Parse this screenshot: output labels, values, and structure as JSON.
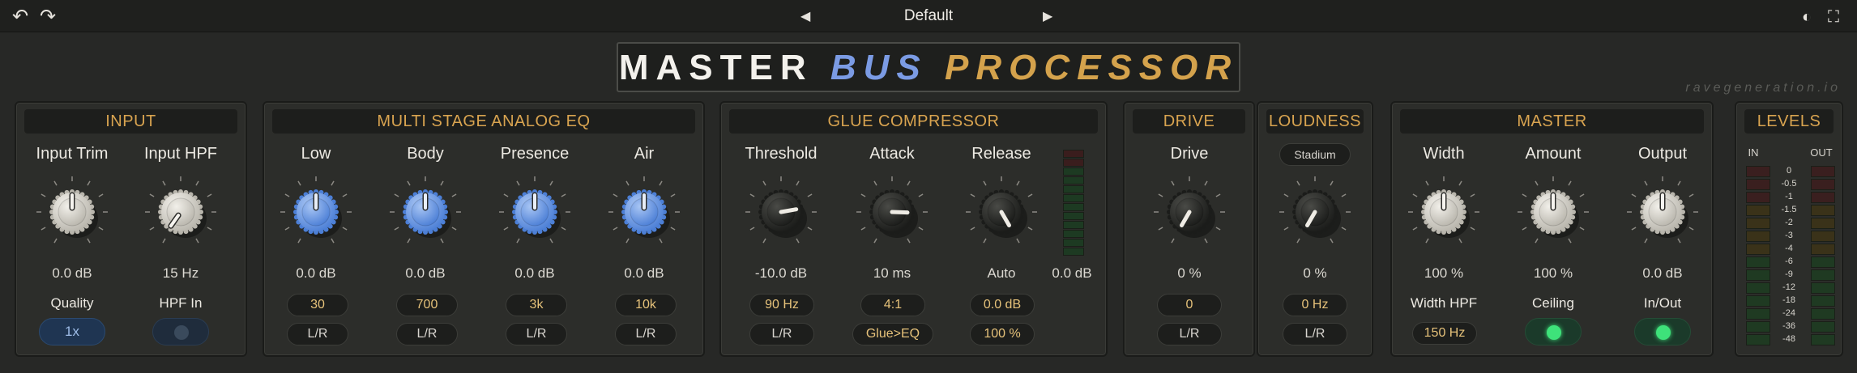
{
  "topbar": {
    "undo": "undo-icon",
    "redo": "redo-icon",
    "preset": "Default",
    "theme": "contrast-icon",
    "fullscreen": "fullscreen-icon"
  },
  "title": {
    "part1": "MASTER",
    "part2": "BUS",
    "part3": "PROCESSOR"
  },
  "brand": "ravegeneration.io",
  "colors": {
    "accent": "#d9a450",
    "blue": "#7b9be4",
    "green": "#3ee27a"
  },
  "input": {
    "title": "INPUT",
    "trim_label": "Input Trim",
    "trim_value": "0.0 dB",
    "hpf_label": "Input HPF",
    "hpf_value": "15 Hz",
    "quality_label": "Quality",
    "quality_value": "1x",
    "hpf_in_label": "HPF In",
    "hpf_in_on": false
  },
  "eq": {
    "title": "MULTI STAGE ANALOG EQ",
    "bands": [
      {
        "label": "Low",
        "value": "0.0 dB",
        "freq": "30",
        "mode": "L/R"
      },
      {
        "label": "Body",
        "value": "0.0 dB",
        "freq": "700",
        "mode": "L/R"
      },
      {
        "label": "Presence",
        "value": "0.0 dB",
        "freq": "3k",
        "mode": "L/R"
      },
      {
        "label": "Air",
        "value": "0.0 dB",
        "freq": "10k",
        "mode": "L/R"
      }
    ]
  },
  "comp": {
    "title": "GLUE COMPRESSOR",
    "threshold_label": "Threshold",
    "threshold_value": "-10.0 dB",
    "threshold_pill1": "90 Hz",
    "threshold_pill2": "L/R",
    "attack_label": "Attack",
    "attack_value": "10 ms",
    "attack_pill1": "4:1",
    "attack_pill2": "Glue>EQ",
    "release_label": "Release",
    "release_value": "Auto",
    "release_pill1": "0.0 dB",
    "release_pill2": "100 %",
    "gr_value": "0.0 dB"
  },
  "drive": {
    "title": "DRIVE",
    "label": "Drive",
    "value": "0 %",
    "pill1": "0",
    "pill2": "L/R"
  },
  "loudness": {
    "title": "LOUDNESS",
    "mode": "Stadium",
    "value": "0 %",
    "pill1": "0 Hz",
    "pill2": "L/R"
  },
  "master": {
    "title": "MASTER",
    "width_label": "Width",
    "width_value": "100 %",
    "width_hpf_label": "Width HPF",
    "width_hpf_value": "150 Hz",
    "amount_label": "Amount",
    "amount_value": "100 %",
    "ceiling_label": "Ceiling",
    "ceiling_on": true,
    "output_label": "Output",
    "output_value": "0.0 dB",
    "inout_label": "In/Out",
    "inout_on": true
  },
  "levels": {
    "title": "LEVELS",
    "in": "IN",
    "out": "OUT",
    "scale": [
      "0",
      "-0.5",
      "-1",
      "-1.5",
      "-2",
      "-3",
      "-4",
      "-6",
      "-9",
      "-12",
      "-18",
      "-24",
      "-36",
      "-48"
    ]
  }
}
